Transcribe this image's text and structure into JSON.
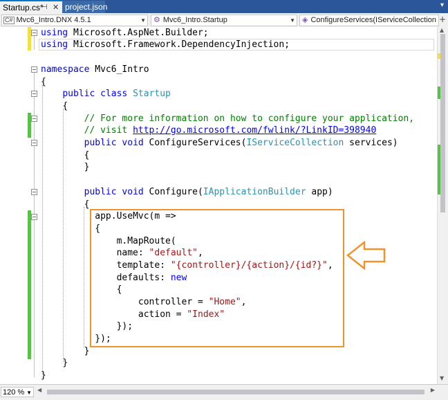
{
  "tabs": [
    {
      "label": "Startup.cs*",
      "active": true
    },
    {
      "label": "project.json",
      "active": false
    }
  ],
  "nav": {
    "project": "Mvc6_Intro.DNX 4.5.1",
    "class": "Mvc6_Intro.Startup",
    "member": "ConfigureServices(IServiceCollection se"
  },
  "code": {
    "l1": {
      "kw": "using",
      "rest": " Microsoft.AspNet.Builder;"
    },
    "l2": {
      "kw": "using",
      "rest": " Microsoft.Framework.DependencyInjection;"
    },
    "l4": {
      "kw": "namespace",
      "rest": " Mvc6_Intro"
    },
    "l5": "{",
    "l6": {
      "kw1": "public",
      "kw2": "class",
      "type": "Startup"
    },
    "l7": "{",
    "l8": "// For more information on how to configure your application,",
    "l9": {
      "prefix": "// visit ",
      "link": "http://go.microsoft.com/fwlink/?LinkID=398940"
    },
    "l10": {
      "kw1": "public",
      "kw2": "void",
      "name": " ConfigureServices(",
      "type": "IServiceCollection",
      "rest": " services)"
    },
    "l11": "{",
    "l12": "}",
    "l14": {
      "kw1": "public",
      "kw2": "void",
      "name": " Configure(",
      "type": "IApplicationBuilder",
      "rest": " app)"
    },
    "l15": "{",
    "l16": "app.UseMvc(m =>",
    "l17": "{",
    "l18": "m.MapRoute(",
    "l19": {
      "pre": "name: ",
      "str": "\"default\"",
      "post": ","
    },
    "l20": {
      "pre": "template: ",
      "str": "\"{controller}/{action}/{id?}\"",
      "post": ","
    },
    "l21": {
      "pre": "defaults: ",
      "kw": "new"
    },
    "l22": "{",
    "l23": {
      "pre": "controller = ",
      "str": "\"Home\"",
      "post": ","
    },
    "l24": {
      "pre": "action = ",
      "str": "\"Index\""
    },
    "l25": "});",
    "l26": "});",
    "l27": "}",
    "l28": "}",
    "l29": "}"
  },
  "zoom": "120 %",
  "colors": {
    "keyword": "#0000ff",
    "type": "#2b91af",
    "comment": "#008000",
    "string": "#a31515",
    "callout": "#f0932b"
  }
}
